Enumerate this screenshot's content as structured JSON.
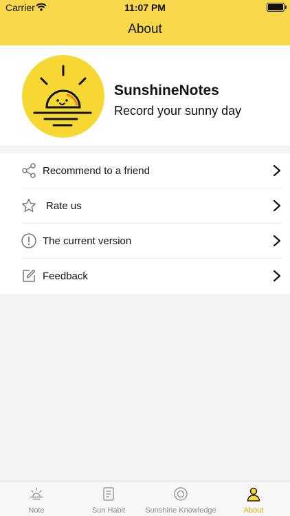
{
  "status_bar": {
    "carrier": "Carrier",
    "time": "11:07 PM"
  },
  "header": {
    "title": "About"
  },
  "profile": {
    "app_name": "SunshineNotes",
    "tagline": "Record your sunny day",
    "logo_icon": "sun-logo-icon"
  },
  "menu": {
    "items": [
      {
        "label": "Recommend to a friend",
        "icon": "share-icon"
      },
      {
        "label": "Rate us",
        "icon": "star-icon"
      },
      {
        "label": "The current version",
        "icon": "info-icon"
      },
      {
        "label": "Feedback",
        "icon": "edit-icon"
      }
    ]
  },
  "tabbar": {
    "tabs": [
      {
        "label": "Note",
        "icon": "sunrise-icon"
      },
      {
        "label": "Sun Habit",
        "icon": "document-icon"
      },
      {
        "label": "Sunshine Knowledge",
        "icon": "circle-icon"
      },
      {
        "label": "About",
        "icon": "person-icon",
        "active": true
      }
    ]
  },
  "colors": {
    "accent": "#f7d84a",
    "active_tab": "#e1a90c",
    "background": "#f4f4f4"
  }
}
